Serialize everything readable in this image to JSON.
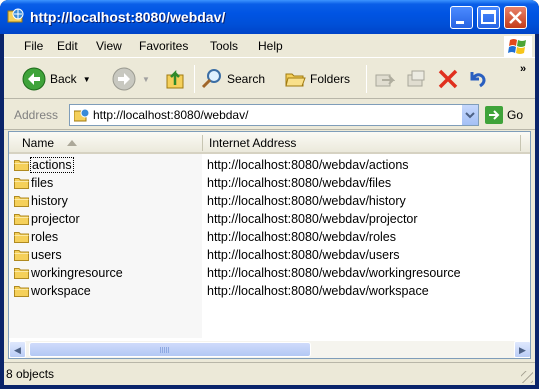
{
  "window": {
    "title": "http://localhost:8080/webdav/"
  },
  "menu": [
    "File",
    "Edit",
    "View",
    "Favorites",
    "Tools",
    "Help"
  ],
  "toolbar": {
    "back_label": "Back",
    "search_label": "Search",
    "folders_label": "Folders",
    "more_glyph": "»"
  },
  "address": {
    "label": "Address",
    "value": "http://localhost:8080/webdav/",
    "go_label": "Go"
  },
  "columns": {
    "name": "Name",
    "internet_address": "Internet Address"
  },
  "items": [
    {
      "name": "actions",
      "address": "http://localhost:8080/webdav/actions"
    },
    {
      "name": "files",
      "address": "http://localhost:8080/webdav/files"
    },
    {
      "name": "history",
      "address": "http://localhost:8080/webdav/history"
    },
    {
      "name": "projector",
      "address": "http://localhost:8080/webdav/projector"
    },
    {
      "name": "roles",
      "address": "http://localhost:8080/webdav/roles"
    },
    {
      "name": "users",
      "address": "http://localhost:8080/webdav/users"
    },
    {
      "name": "workingresource",
      "address": "http://localhost:8080/webdav/workingresource"
    },
    {
      "name": "workspace",
      "address": "http://localhost:8080/webdav/workspace"
    }
  ],
  "status": {
    "text": "8 objects"
  },
  "colors": {
    "title_blue": "#0054e3",
    "chrome": "#ece9d8",
    "folder_yellow": "#f5d05a"
  }
}
